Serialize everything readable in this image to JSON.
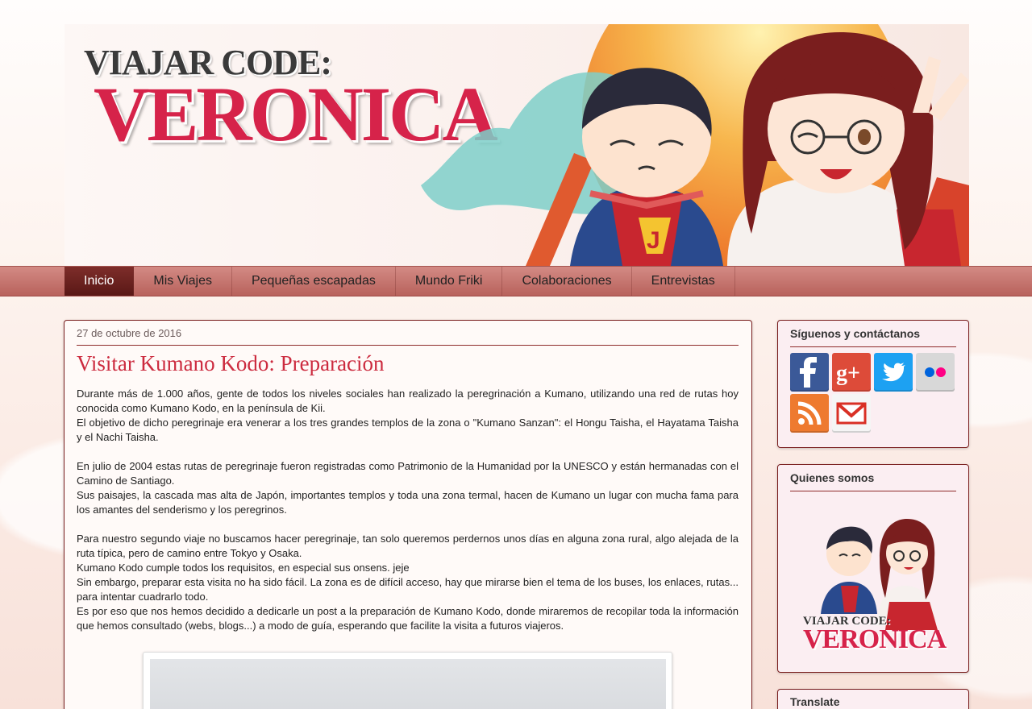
{
  "header": {
    "title_top": "VIAJAR CODE:",
    "title_main": "VERONICA"
  },
  "nav": {
    "items": [
      {
        "label": "Inicio",
        "active": true
      },
      {
        "label": "Mis Viajes"
      },
      {
        "label": "Pequeñas escapadas"
      },
      {
        "label": "Mundo Friki"
      },
      {
        "label": "Colaboraciones"
      },
      {
        "label": "Entrevistas"
      }
    ]
  },
  "post": {
    "date": "27 de octubre de 2016",
    "title": "Visitar Kumano Kodo: Preparación",
    "paragraphs": [
      "Durante más de 1.000 años, gente de todos los niveles sociales han realizado la peregrinación a Kumano, utilizando una red de rutas hoy conocida como Kumano Kodo, en la península de Kii.",
      "El objetivo de dicho peregrinaje era venerar a los tres grandes templos de la zona o \"Kumano Sanzan\": el Hongu Taisha, el Hayatama Taisha y el Nachi Taisha.",
      "En julio de 2004 estas rutas de peregrinaje fueron registradas como Patrimonio de la Humanidad por la UNESCO y están hermanadas con el Camino de Santiago.",
      "Sus paisajes, la cascada mas alta de Japón, importantes templos y toda una zona termal, hacen de Kumano un lugar con mucha fama para los amantes del senderismo y los peregrinos.",
      "Para nuestro segundo viaje no buscamos hacer peregrinaje, tan solo queremos perdernos unos días en alguna zona rural, algo alejada de la ruta típica, pero de camino entre Tokyo y Osaka.",
      "Kumano Kodo cumple todos los requisitos, en especial sus onsens. jeje",
      "Sin embargo, preparar esta visita no ha sido fácil. La zona es de difícil acceso, hay que mirarse bien el tema de los buses, los enlaces, rutas... para intentar cuadrarlo todo.",
      "Es por eso que nos hemos decidido a dedicarle un post a la preparación de Kumano Kodo, donde miraremos de recopilar toda la información que hemos consultado (webs, blogs...) a modo de guía, esperando que facilite la visita a futuros viajeros."
    ]
  },
  "sidebar": {
    "follow_title": "Síguenos y contáctanos",
    "social": [
      {
        "icon": "facebook-icon",
        "color": "#3b5998"
      },
      {
        "icon": "google-plus-icon",
        "color": "#dd4b39"
      },
      {
        "icon": "twitter-icon",
        "color": "#1da1f2"
      },
      {
        "icon": "flickr-icon",
        "color": "#cccccc"
      },
      {
        "icon": "rss-icon",
        "color": "#ee7a2f"
      },
      {
        "icon": "gmail-icon",
        "color": "#d93025"
      }
    ],
    "about_title": "Quienes somos",
    "about_logo_top": "VIAJAR CODE:",
    "about_logo_main": "VERONICA",
    "translate_title": "Translate"
  },
  "colors": {
    "accent": "#cc2b3f",
    "nav_active": "#6b2220",
    "border": "#7a1f1f"
  }
}
